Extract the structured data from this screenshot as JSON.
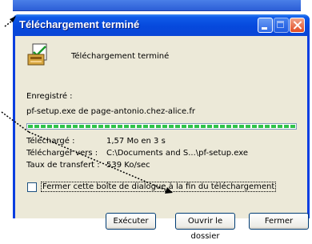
{
  "window": {
    "title": "Téléchargement terminé",
    "buttons": [
      "minimize",
      "maximize",
      "close"
    ]
  },
  "header": {
    "icon": "downloaded-file-icon",
    "text": "Téléchargement terminé"
  },
  "saved": {
    "label": "Enregistré :",
    "value": "pf-setup.exe de page-antonio.chez-alice.fr"
  },
  "progress": {
    "percent": 100
  },
  "details": [
    {
      "label": "Téléchargé :",
      "value": "1,57 Mo en 3 s"
    },
    {
      "label": "Télécharger vers :",
      "value": "C:\\Documents and S...\\pf-setup.exe"
    },
    {
      "label": "Taux de transfert :",
      "value": "539 Ko/sec"
    }
  ],
  "close_when_done": {
    "label": "Fermer cette boîte de dialogue à la fin du téléchargement",
    "checked": false
  },
  "actions": {
    "execute": "Exécuter",
    "open_folder": "Ouvrir le dossier",
    "close": "Fermer"
  },
  "colors": {
    "titlebar": "#0a46d6",
    "progress": "#2ec24a",
    "dialog_bg": "#ece9d8"
  }
}
